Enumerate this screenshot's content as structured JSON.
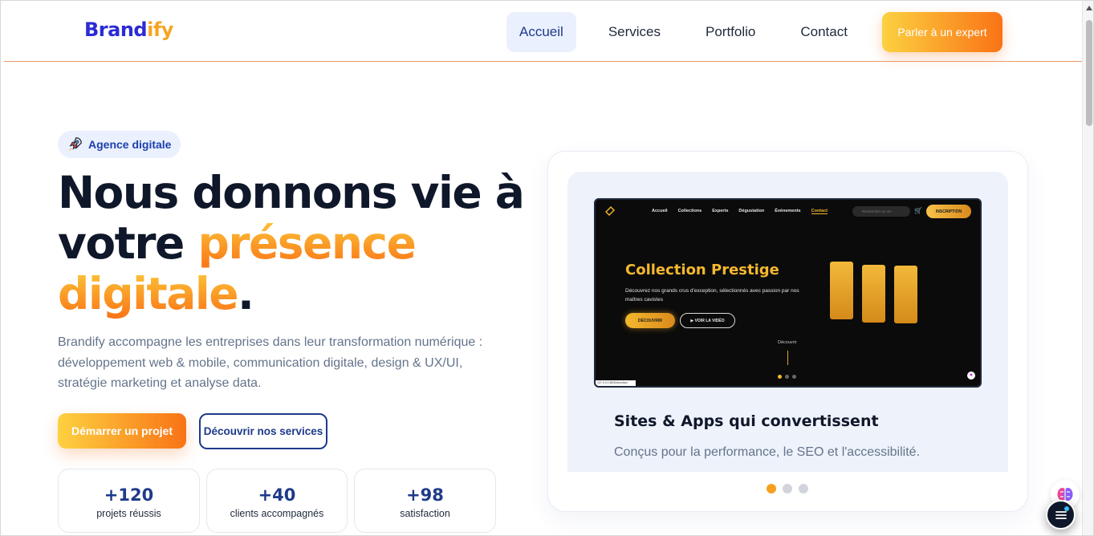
{
  "header": {
    "logo_part1": "Brand",
    "logo_part2": "ify",
    "nav": [
      {
        "label": "Accueil",
        "active": true
      },
      {
        "label": "Services",
        "active": false
      },
      {
        "label": "Portfolio",
        "active": false
      },
      {
        "label": "Contact",
        "active": false
      }
    ],
    "cta": "Parler à un expert"
  },
  "hero": {
    "badge": "Agence digitale",
    "title_line1": "Nous donnons vie à",
    "title_line2_plain": "votre ",
    "title_line2_highlight": "présence",
    "title_line3_highlight": "digitale",
    "title_line3_end": ".",
    "description": "Brandify accompagne les entreprises dans leur transformation numérique : développement web & mobile, communication digitale, design & UX/UI, stratégie marketing et analyse data.",
    "primary_button": "Démarrer un projet",
    "secondary_button": "Découvrir nos services",
    "stats": [
      {
        "value": "+120",
        "label": "projets réussis"
      },
      {
        "value": "+40",
        "label": "clients accompagnés"
      },
      {
        "value": "+98",
        "label": "satisfaction"
      }
    ]
  },
  "showcase": {
    "mock": {
      "nav": [
        "Accueil",
        "Collections",
        "Experts",
        "Dégustation",
        "Événements",
        "Contact"
      ],
      "active_nav": "Contact",
      "search_placeholder": "Rechercher un vin",
      "signup": "INSCRIPTION",
      "title": "Collection Prestige",
      "description": "Découvrez nos grands crus d'exception, sélectionnés avec passion par nos maîtres cavistes",
      "button_discover": "DÉCOUVRIR",
      "button_video": "▶ VOIR LA VIDÉO",
      "scroll_label": "Découvrir",
      "corner_text": "127.0.0.1:8000/#contact"
    },
    "title": "Sites & Apps qui convertissent",
    "subtitle": "Conçus pour la performance, le SEO et l'accessibilité.",
    "carousel_active": 1,
    "carousel_count": 3
  },
  "colors": {
    "brand_blue": "#2b2bd6",
    "brand_orange": "#f97316",
    "brand_yellow": "#fdd140",
    "navy": "#1e3a8a"
  },
  "icons": {
    "badge": "rocket-icon",
    "menu": "hamburger-menu-icon",
    "assistant": "brain-icon"
  }
}
